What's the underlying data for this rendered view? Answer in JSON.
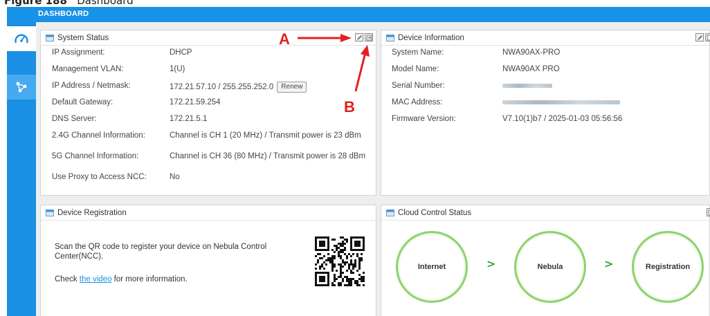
{
  "caption": {
    "prefix": "Figure 188",
    "title": "Dashboard"
  },
  "header": {
    "title": "DASHBOARD"
  },
  "sidebar": {
    "items": [
      {
        "icon": "dashboard-gauge-icon"
      },
      {
        "icon": "network-share-icon"
      }
    ]
  },
  "system_status": {
    "title": "System Status",
    "rows": [
      {
        "label": "IP Assignment:",
        "value": "DHCP"
      },
      {
        "label": "Management VLAN:",
        "value": "1(U)"
      },
      {
        "label": "IP Address / Netmask:",
        "value": "172.21.57.10 / 255.255.252.0"
      },
      {
        "label": "Default Gateway:",
        "value": "172.21.59.254"
      },
      {
        "label": "DNS Server:",
        "value": "172.21.5.1"
      },
      {
        "label": "2.4G Channel Information:",
        "value": "Channel is CH 1 (20 MHz) / Transmit power is 23 dBm"
      },
      {
        "label": "5G Channel Information:",
        "value": "Channel is CH 36 (80 MHz) / Transmit power is 28 dBm"
      },
      {
        "label": "Use Proxy to Access NCC:",
        "value": "No"
      }
    ],
    "renew_label": "Renew"
  },
  "device_info": {
    "title": "Device Information",
    "rows": [
      {
        "label": "System Name:",
        "value": "NWA90AX-PRO"
      },
      {
        "label": "Model Name:",
        "value": "NWA90AX PRO"
      },
      {
        "label": "Serial Number:",
        "value": ""
      },
      {
        "label": "MAC Address:",
        "value": ""
      },
      {
        "label": "Firmware Version:",
        "value": "V7.10(1)b7 / 2025-01-03 05:56:56"
      }
    ]
  },
  "device_registration": {
    "title": "Device Registration",
    "text": "Scan the QR code to register your device on Nebula Control Center(NCC).",
    "check_prefix": "Check ",
    "link_text": "the video",
    "check_suffix": " for more information."
  },
  "cloud_status": {
    "title": "Cloud Control Status",
    "nodes": [
      "Internet",
      "Nebula",
      "Registration"
    ],
    "separator": ">"
  },
  "annotations": {
    "a": "A",
    "b": "B"
  },
  "colors": {
    "accent": "#1891e8",
    "status_green": "#8cd36a",
    "annotation_red": "#e32020"
  }
}
